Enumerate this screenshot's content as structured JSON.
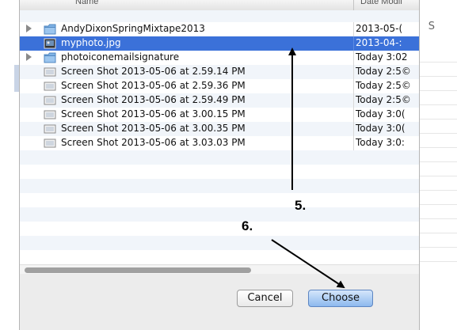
{
  "background": {
    "right_letter": "S"
  },
  "file_list": {
    "header": {
      "name": "Name",
      "date": "Date Modif"
    },
    "rows": [
      {
        "name": "AndyDixonSpringMixtape2013",
        "date": "2013-05-(",
        "type": "folder",
        "disclosure": true,
        "selected": false
      },
      {
        "name": "myphoto.jpg",
        "date": "2013-04-:",
        "type": "image",
        "disclosure": false,
        "selected": true
      },
      {
        "name": "photoiconemailsignature",
        "date": "Today 3:02",
        "type": "folder",
        "disclosure": true,
        "selected": false
      },
      {
        "name": "Screen Shot 2013-05-06 at 2.59.14 PM",
        "date": "Today 2:5©",
        "type": "screenshot",
        "disclosure": false,
        "selected": false
      },
      {
        "name": "Screen Shot 2013-05-06 at 2.59.36 PM",
        "date": "Today 2:5©",
        "type": "screenshot",
        "disclosure": false,
        "selected": false
      },
      {
        "name": "Screen Shot 2013-05-06 at 2.59.49 PM",
        "date": "Today 2:5©",
        "type": "screenshot",
        "disclosure": false,
        "selected": false
      },
      {
        "name": "Screen Shot 2013-05-06 at 3.00.15 PM",
        "date": "Today 3:0(",
        "type": "screenshot",
        "disclosure": false,
        "selected": false
      },
      {
        "name": "Screen Shot 2013-05-06 at 3.00.35 PM",
        "date": "Today 3:0(",
        "type": "screenshot",
        "disclosure": false,
        "selected": false
      },
      {
        "name": "Screen Shot 2013-05-06 at 3.03.03 PM",
        "date": "Today 3:0:",
        "type": "screenshot",
        "disclosure": false,
        "selected": false
      }
    ],
    "empty_row_count": 7
  },
  "buttons": {
    "cancel": "Cancel",
    "choose": "Choose"
  },
  "annotations": {
    "step5": "5.",
    "step6": "6."
  },
  "colors": {
    "selection": "#3b71d9",
    "folder": "#7fb2e5",
    "choose_button": "#8db9ee"
  }
}
